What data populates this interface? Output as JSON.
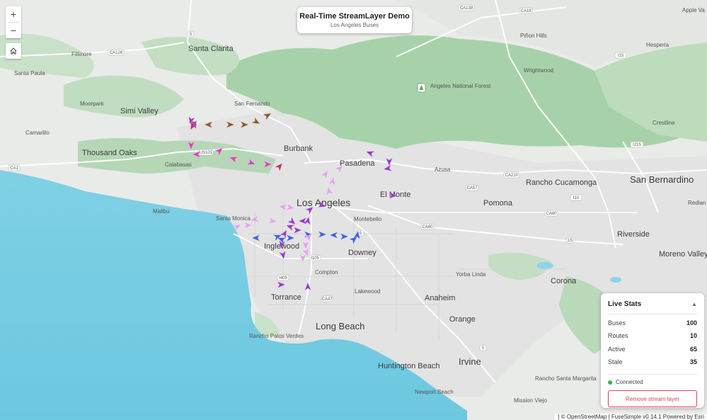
{
  "app_title": "Real-Time StreamLayer Demo",
  "app_subtitle": "Los Angeles Buses",
  "zoom": {
    "in_label": "+",
    "out_label": "−"
  },
  "home_icon": "home-icon",
  "stats": {
    "title": "Live Stats",
    "collapse_glyph": "▲",
    "rows": [
      {
        "label": "Buses",
        "value": "100"
      },
      {
        "label": "Routes",
        "value": "10"
      },
      {
        "label": "Active",
        "value": "65"
      },
      {
        "label": "Stale",
        "value": "35"
      }
    ],
    "status": "Connected",
    "status_color": "#3cb44b",
    "button": "Remove stream layer",
    "button_color": "#d8445f"
  },
  "attribution": "| © OpenStreetMap  | FuseSimple v0.14.1  Powered by Esri",
  "places": {
    "santa_clarita": "Santa Clarita",
    "fillmore": "Fillmore",
    "santa_paula": "Santa Paula",
    "simi_valley": "Simi Valley",
    "moorpark": "Moorpark",
    "camarillo": "Camarillo",
    "thousand_oaks": "Thousand Oaks",
    "calabasas": "Calabasas",
    "malibu": "Malibu",
    "san_fernando": "San Fernando",
    "burbank": "Burbank",
    "pasadena": "Pasadena",
    "azusa": "Azusa",
    "los_angeles": "Los Angeles",
    "el_monte": "El Monte",
    "santa_monica": "Santa Monica",
    "montebello": "Montebello",
    "inglewood": "Inglewood",
    "downey": "Downey",
    "compton": "Compton",
    "torrance": "Torrance",
    "lakewood": "Lakewood",
    "long_beach": "Long Beach",
    "rancho_palos_verdes": "Rancho Palos Verdes",
    "anaheim": "Anaheim",
    "orange": "Orange",
    "yorba_linda": "Yorba Linda",
    "pomona": "Pomona",
    "rancho_cucamonga": "Rancho Cucamonga",
    "san_bernardino": "San Bernardino",
    "riverside": "Riverside",
    "corona": "Corona",
    "moreno_valley": "Moreno Valley",
    "huntington_beach": "Huntington Beach",
    "irvine": "Irvine",
    "newport_beach": "Newport Beach",
    "mission_viejo": "Mission Viejo",
    "rancho_santa_margarita": "Rancho Santa Margarita",
    "pinon_hills": "Piñon Hills",
    "hesperia": "Hesperia",
    "wrightwood": "Wrightwood",
    "angeles_nf": "Angeles National Forest",
    "crestline": "Crestline",
    "redlands": "Redlan",
    "apple_valley": "Apple Va"
  },
  "shields": {
    "ca138": "CA138",
    "ca18": "CA18",
    "i5": "5",
    "ca126": "CA126",
    "i15": "I15",
    "ca1": "CA1",
    "us101": "US101",
    "ca210": "CA210",
    "i215": "I215",
    "ca57": "CA57",
    "i10": "I10",
    "ca60a": "CA60",
    "ca60b": "CA60",
    "i5b": "5",
    "i15b": "15",
    "i105": "I105",
    "i405": "I405",
    "ca47": "CA47",
    "i5c": "5"
  },
  "route_colors": [
    "#8b5a2b",
    "#e040c0",
    "#9a3ad0",
    "#4060e0",
    "#e6a0f0",
    "#c0306a"
  ]
}
